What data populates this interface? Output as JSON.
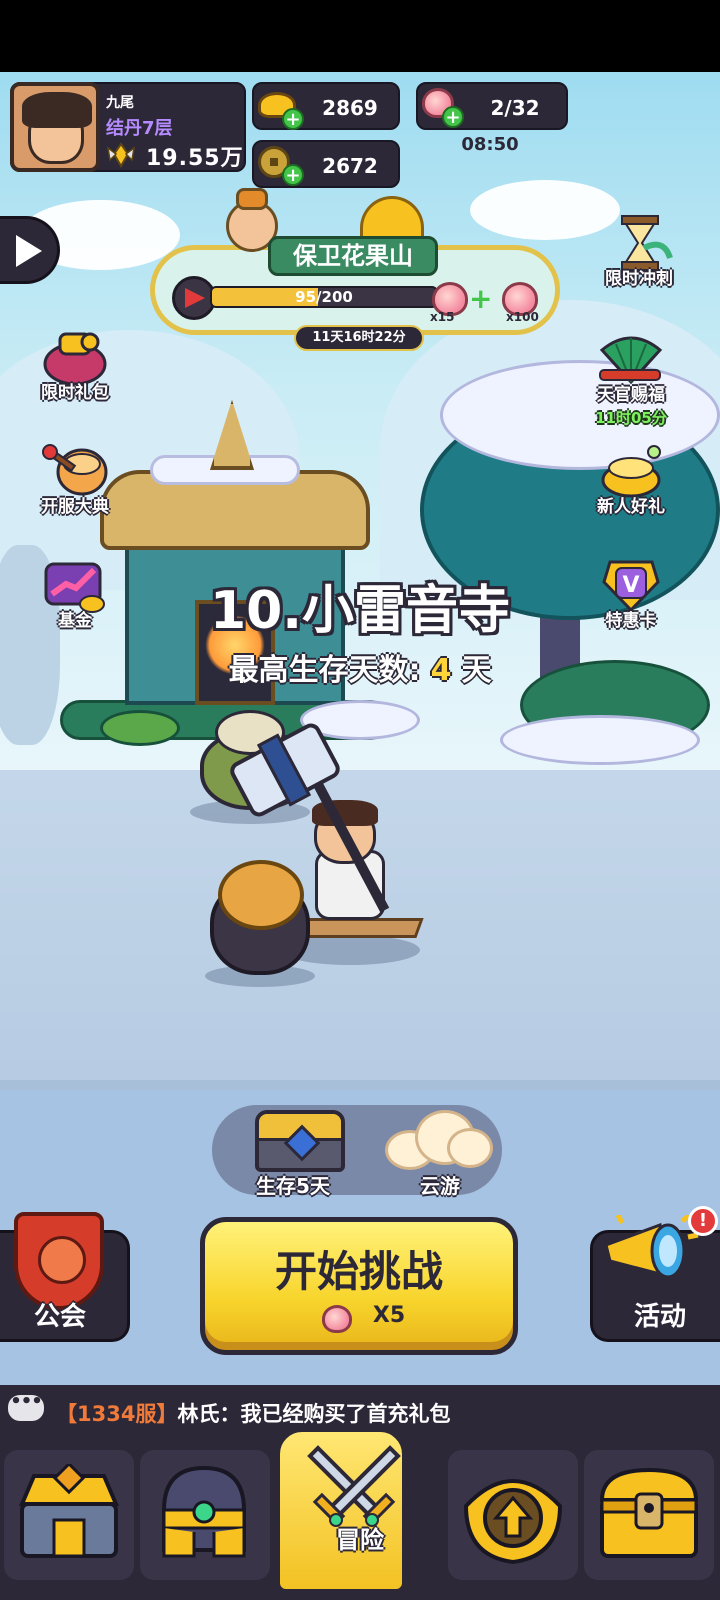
{
  "player": {
    "name": "九尾",
    "rank": "结丹7层",
    "power": "19.55万"
  },
  "currency": {
    "gold": "2869",
    "coins": "2672",
    "stamina": "2/32",
    "stamina_timer": "08:50"
  },
  "event": {
    "title": "保卫花果山",
    "progress_text": "95/200",
    "progress": 0.475,
    "reward_left_qty": "x15",
    "reward_right_qty": "x100",
    "countdown": "11天16时22分"
  },
  "left_menu": [
    {
      "label": "限时礼包",
      "icon": "gift-bag-icon"
    },
    {
      "label": "开服大典",
      "icon": "drum-icon"
    },
    {
      "label": "基金",
      "icon": "fund-chart-icon"
    }
  ],
  "right_menu": [
    {
      "label": "限时冲刺",
      "icon": "hourglass-icon"
    },
    {
      "label": "天官赐福",
      "icon": "fan-icon",
      "timer": "11时05分"
    },
    {
      "label": "新人好礼",
      "icon": "gold-pot-icon"
    },
    {
      "label": "特惠卡",
      "icon": "vip-card-icon"
    }
  ],
  "stage": {
    "title": "10.小雷音寺",
    "best_label": "最高生存天数:",
    "best_value": "4",
    "best_unit": "天"
  },
  "rewards": {
    "chest_label": "生存5天",
    "cloud_label": "云游"
  },
  "actions": {
    "guild": "公会",
    "start": "开始挑战",
    "start_cost": "X5",
    "events": "活动",
    "events_badge": "!"
  },
  "chat": {
    "server": "【1334服】",
    "message": "林氏：我已经购买了首充礼包"
  },
  "nav": {
    "active_label": "冒险",
    "items": [
      "shop-chest-icon",
      "helmet-icon",
      "crossed-swords-icon",
      "upgrade-arrow-icon",
      "treasure-chest-icon"
    ]
  },
  "colors": {
    "accent_yellow": "#f8d52d",
    "panel_dark": "#2c2838",
    "timer_green": "#7ff05f",
    "rank_purple": "#b58bff"
  }
}
